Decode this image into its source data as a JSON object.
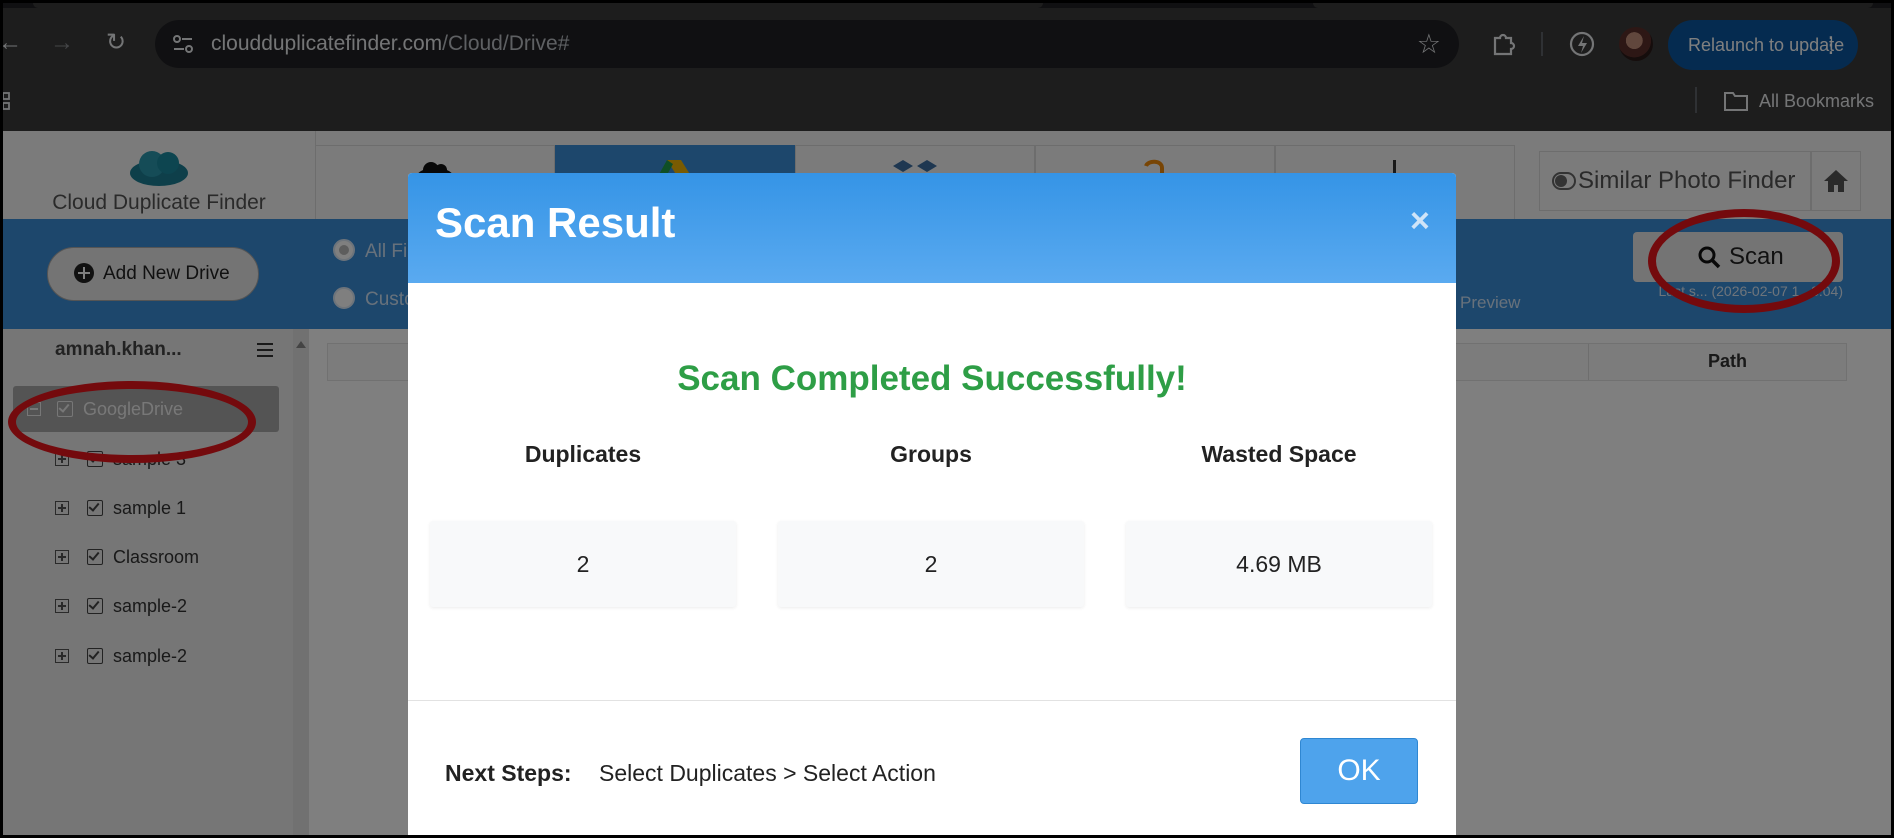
{
  "browser": {
    "url_host": "cloudduplicatefinder.com",
    "url_path": "/Cloud/Drive#",
    "relaunch_label": "Relaunch to update",
    "bookmarks_label": "All Bookmarks"
  },
  "app": {
    "brand_name": "Cloud Duplicate Finder",
    "similar_photo_label": "Similar Photo Finder",
    "add_drive_label": "Add New Drive",
    "filter_all_label": "All Fi",
    "filter_custom_label": "Custo",
    "preview_label": "Preview",
    "scan_label": "Scan",
    "last_scan_text": "Last s... (2026-02-07 1...8:04)",
    "account_name": "amnah.khan...",
    "table_path_header": "Path",
    "tree": {
      "root": "GoogleDrive",
      "items": [
        "sample 3",
        "sample 1",
        "Classroom",
        "sample-2",
        "sample-2"
      ]
    }
  },
  "modal": {
    "title": "Scan Result",
    "close_glyph": "×",
    "success_message": "Scan Completed Successfully!",
    "stats": [
      {
        "label": "Duplicates",
        "value": "2"
      },
      {
        "label": "Groups",
        "value": "2"
      },
      {
        "label": "Wasted Space",
        "value": "4.69 MB"
      }
    ],
    "next_steps_label": "Next Steps:",
    "next_steps_text": "Select Duplicates > Select Action",
    "ok_label": "OK"
  },
  "colors": {
    "header_blue": "#3b8fd9",
    "success_green": "#2e9e46",
    "annotation_red": "#e8141b",
    "ok_button": "#4ea3ec"
  }
}
